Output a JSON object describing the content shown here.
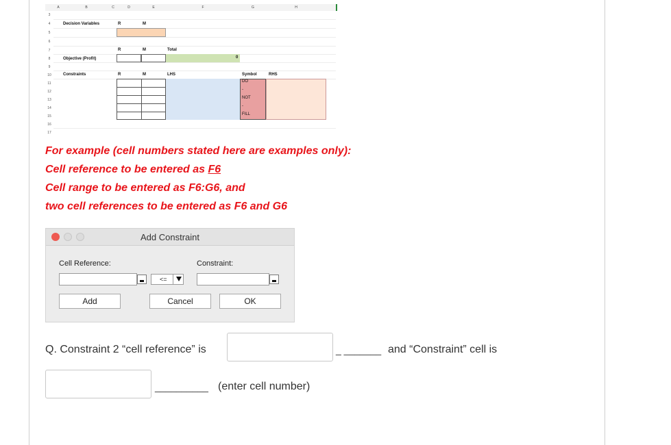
{
  "sheet": {
    "columns": [
      "A",
      "B",
      "C",
      "D",
      "E",
      "F",
      "G",
      "H"
    ],
    "rows": [
      "3",
      "4",
      "5",
      "6",
      "7",
      "8",
      "9",
      "10",
      "11",
      "12",
      "13",
      "14",
      "15",
      "16",
      "17"
    ],
    "decision_variables_label": "Decision Variables",
    "objective_label": "Objective (Profit)",
    "constraints_label": "Constraints",
    "r_label": "R",
    "m_label": "M",
    "total_label": "Total",
    "lhs_label": "LHS",
    "symbol_label": "Symbol",
    "rhs_label": "RHS",
    "total_value": "0",
    "symbols": [
      "DO",
      "-",
      "NOT",
      "-",
      "FILL"
    ],
    "colors": {
      "orange": "#fbd5b4",
      "green": "#cfe3b3",
      "blue": "#d9e6f5",
      "red": "#e8a0a0",
      "peach": "#fde6d8"
    }
  },
  "instructions": {
    "line1": "For example (cell numbers stated here are examples only):",
    "line2_prefix": "Cell reference to be entered as ",
    "line2_example": "F6 ",
    "line3": "Cell range to be entered as F6:G6, and",
    "line4": "two cell references to be entered as F6 and G6"
  },
  "dialog": {
    "title": "Add Constraint",
    "cell_reference_label": "Cell Reference:",
    "constraint_label": "Constraint:",
    "operator": "<=",
    "add_label": "Add",
    "cancel_label": "Cancel",
    "ok_label": "OK"
  },
  "question": {
    "prefix": "Q. Constraint 2 “cell reference” is",
    "dash1": "_ _______",
    "middle": "and “Constraint” cell is",
    "dash2": "__________",
    "suffix": "(enter cell number)"
  }
}
